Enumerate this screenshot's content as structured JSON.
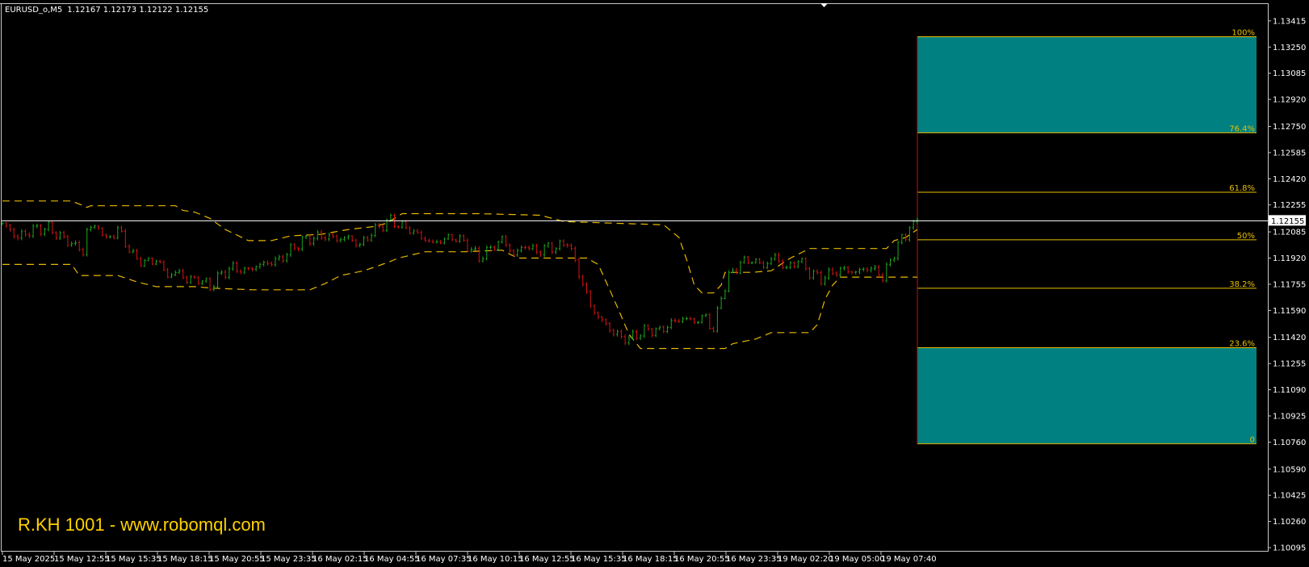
{
  "header": {
    "symbol": "EURUSD_o,M5",
    "ohlc": "1.12167 1.12173 1.12122 1.12155"
  },
  "watermark": "R.KH 1001 - www.robomql.com",
  "colors": {
    "background": "#000000",
    "bull_candle": "#1fa51f",
    "bear_candle": "#d41414",
    "channel": "#e8b800",
    "fib_fill": "#008080",
    "fib_line": "#e8c000",
    "fib_trend": "#c01010",
    "price_line": "#ffffff"
  },
  "chart_data": {
    "type": "candlestick",
    "symbol": "EURUSD_o",
    "timeframe": "M5",
    "ylim": [
      1.10095,
      1.13455
    ],
    "y_ticks": [
      "1.13415",
      "1.13250",
      "1.13085",
      "1.12920",
      "1.12750",
      "1.12585",
      "1.12420",
      "1.12255",
      "1.12085",
      "1.11920",
      "1.11755",
      "1.11590",
      "1.11420",
      "1.11255",
      "1.11090",
      "1.10925",
      "1.10760",
      "1.10590",
      "1.10425",
      "1.10260",
      "1.10095"
    ],
    "x_ticks": [
      "15 May 2025",
      "15 May 12:55",
      "15 May 15:35",
      "15 May 18:15",
      "15 May 20:55",
      "15 May 23:35",
      "16 May 02:15",
      "16 May 04:55",
      "16 May 07:35",
      "16 May 10:15",
      "16 May 12:55",
      "16 May 15:35",
      "16 May 18:15",
      "16 May 20:55",
      "16 May 23:35",
      "19 May 02:20",
      "19 May 05:00",
      "19 May 07:40"
    ],
    "current_price": 1.12155,
    "current_price_label": "1.12155",
    "close_path": [
      [
        0,
        1.1214
      ],
      [
        4,
        1.1205
      ],
      [
        8,
        1.121
      ],
      [
        12,
        1.1211
      ],
      [
        16,
        1.1204
      ],
      [
        19,
        1.12
      ],
      [
        21,
        1.1195
      ],
      [
        22,
        1.121
      ],
      [
        25,
        1.1212
      ],
      [
        27,
        1.1203
      ],
      [
        30,
        1.121
      ],
      [
        32,
        1.1202
      ],
      [
        34,
        1.1193
      ],
      [
        37,
        1.1189
      ],
      [
        40,
        1.1191
      ],
      [
        43,
        1.1181
      ],
      [
        46,
        1.1183
      ],
      [
        48,
        1.1178
      ],
      [
        51,
        1.1179
      ],
      [
        54,
        1.1174
      ],
      [
        57,
        1.1182
      ],
      [
        60,
        1.1186
      ],
      [
        63,
        1.1184
      ],
      [
        66,
        1.1187
      ],
      [
        69,
        1.1189
      ],
      [
        72,
        1.1191
      ],
      [
        75,
        1.1197
      ],
      [
        78,
        1.1203
      ],
      [
        81,
        1.1205
      ],
      [
        84,
        1.1206
      ],
      [
        87,
        1.1204
      ],
      [
        90,
        1.1205
      ],
      [
        93,
        1.12
      ],
      [
        96,
        1.1208
      ],
      [
        99,
        1.1213
      ],
      [
        101,
        1.1216
      ],
      [
        103,
        1.1213
      ],
      [
        106,
        1.121
      ],
      [
        109,
        1.1205
      ],
      [
        112,
        1.1201
      ],
      [
        115,
        1.1204
      ],
      [
        118,
        1.1205
      ],
      [
        121,
        1.12
      ],
      [
        124,
        1.1192
      ],
      [
        127,
        1.1198
      ],
      [
        130,
        1.1204
      ],
      [
        133,
        1.1194
      ],
      [
        136,
        1.12
      ],
      [
        139,
        1.1196
      ],
      [
        142,
        1.1199
      ],
      [
        145,
        1.1199
      ],
      [
        147,
        1.1203
      ],
      [
        149,
        1.1189
      ],
      [
        151,
        1.1176
      ],
      [
        153,
        1.1162
      ],
      [
        155,
        1.1155
      ],
      [
        157,
        1.115
      ],
      [
        159,
        1.1145
      ],
      [
        161,
        1.1142
      ],
      [
        163,
        1.1141
      ],
      [
        165,
        1.1144
      ],
      [
        168,
        1.1147
      ],
      [
        171,
        1.1146
      ],
      [
        174,
        1.1151
      ],
      [
        177,
        1.1154
      ],
      [
        180,
        1.1152
      ],
      [
        183,
        1.1155
      ],
      [
        185,
        1.1146
      ],
      [
        187,
        1.1168
      ],
      [
        189,
        1.118
      ],
      [
        192,
        1.1189
      ],
      [
        195,
        1.1191
      ],
      [
        198,
        1.1187
      ],
      [
        201,
        1.1193
      ],
      [
        204,
        1.1185
      ],
      [
        207,
        1.1191
      ],
      [
        210,
        1.1183
      ],
      [
        213,
        1.1179
      ],
      [
        216,
        1.1183
      ],
      [
        219,
        1.1185
      ],
      [
        222,
        1.1183
      ],
      [
        225,
        1.1186
      ],
      [
        228,
        1.1183
      ],
      [
        229,
        1.118
      ],
      [
        231,
        1.119
      ],
      [
        233,
        1.1201
      ],
      [
        235,
        1.1206
      ],
      [
        236,
        1.1213
      ],
      [
        237,
        1.1212
      ],
      [
        238,
        1.1216
      ]
    ],
    "channel_upper": [
      [
        0,
        1.1228
      ],
      [
        18,
        1.1228
      ],
      [
        20,
        1.1226
      ],
      [
        22,
        1.1224
      ],
      [
        23,
        1.1225
      ],
      [
        40,
        1.1225
      ],
      [
        45,
        1.1225
      ],
      [
        47,
        1.1222
      ],
      [
        50,
        1.1221
      ],
      [
        54,
        1.1217
      ],
      [
        58,
        1.121
      ],
      [
        64,
        1.1203
      ],
      [
        70,
        1.1203
      ],
      [
        75,
        1.1206
      ],
      [
        83,
        1.1207
      ],
      [
        90,
        1.121
      ],
      [
        97,
        1.1212
      ],
      [
        100,
        1.1214
      ],
      [
        104,
        1.122
      ],
      [
        110,
        1.122
      ],
      [
        118,
        1.122
      ],
      [
        124,
        1.122
      ],
      [
        140,
        1.1219
      ],
      [
        146,
        1.1215
      ],
      [
        172,
        1.1213
      ],
      [
        176,
        1.1205
      ],
      [
        178,
        1.1191
      ],
      [
        180,
        1.1175
      ],
      [
        182,
        1.117
      ],
      [
        185,
        1.117
      ],
      [
        187,
        1.1175
      ],
      [
        188,
        1.1183
      ],
      [
        195,
        1.1183
      ],
      [
        200,
        1.1184
      ],
      [
        205,
        1.1192
      ],
      [
        210,
        1.1198
      ],
      [
        215,
        1.1198
      ],
      [
        230,
        1.1198
      ],
      [
        232,
        1.1203
      ],
      [
        235,
        1.1205
      ],
      [
        238,
        1.121
      ]
    ],
    "channel_lower": [
      [
        0,
        1.1188
      ],
      [
        18,
        1.1188
      ],
      [
        20,
        1.1181
      ],
      [
        30,
        1.1181
      ],
      [
        35,
        1.1177
      ],
      [
        40,
        1.1174
      ],
      [
        50,
        1.1174
      ],
      [
        55,
        1.1173
      ],
      [
        65,
        1.1172
      ],
      [
        80,
        1.1172
      ],
      [
        84,
        1.1176
      ],
      [
        88,
        1.1181
      ],
      [
        94,
        1.1184
      ],
      [
        100,
        1.1189
      ],
      [
        103,
        1.1192
      ],
      [
        110,
        1.1196
      ],
      [
        120,
        1.1196
      ],
      [
        130,
        1.1197
      ],
      [
        134,
        1.1192
      ],
      [
        152,
        1.1192
      ],
      [
        155,
        1.1188
      ],
      [
        158,
        1.1172
      ],
      [
        160,
        1.1161
      ],
      [
        163,
        1.1144
      ],
      [
        166,
        1.1135
      ],
      [
        175,
        1.1135
      ],
      [
        188,
        1.1135
      ],
      [
        190,
        1.1138
      ],
      [
        196,
        1.1141
      ],
      [
        200,
        1.1145
      ],
      [
        210,
        1.1145
      ],
      [
        212,
        1.115
      ],
      [
        214,
        1.1166
      ],
      [
        216,
        1.1175
      ],
      [
        218,
        1.118
      ],
      [
        238,
        1.118
      ]
    ],
    "fibonacci": {
      "levels": [
        {
          "label": "100%",
          "value": 1.13315
        },
        {
          "label": "76.4%",
          "value": 1.1271
        },
        {
          "label": "61.8%",
          "value": 1.12335
        },
        {
          "label": "50%",
          "value": 1.12035
        },
        {
          "label": "38.2%",
          "value": 1.1173
        },
        {
          "label": "23.6%",
          "value": 1.11355
        },
        {
          "label": "0",
          "value": 1.1075
        }
      ],
      "shaded_zones": [
        [
          1.1271,
          1.13315
        ],
        [
          1.1075,
          1.11355
        ]
      ]
    }
  }
}
